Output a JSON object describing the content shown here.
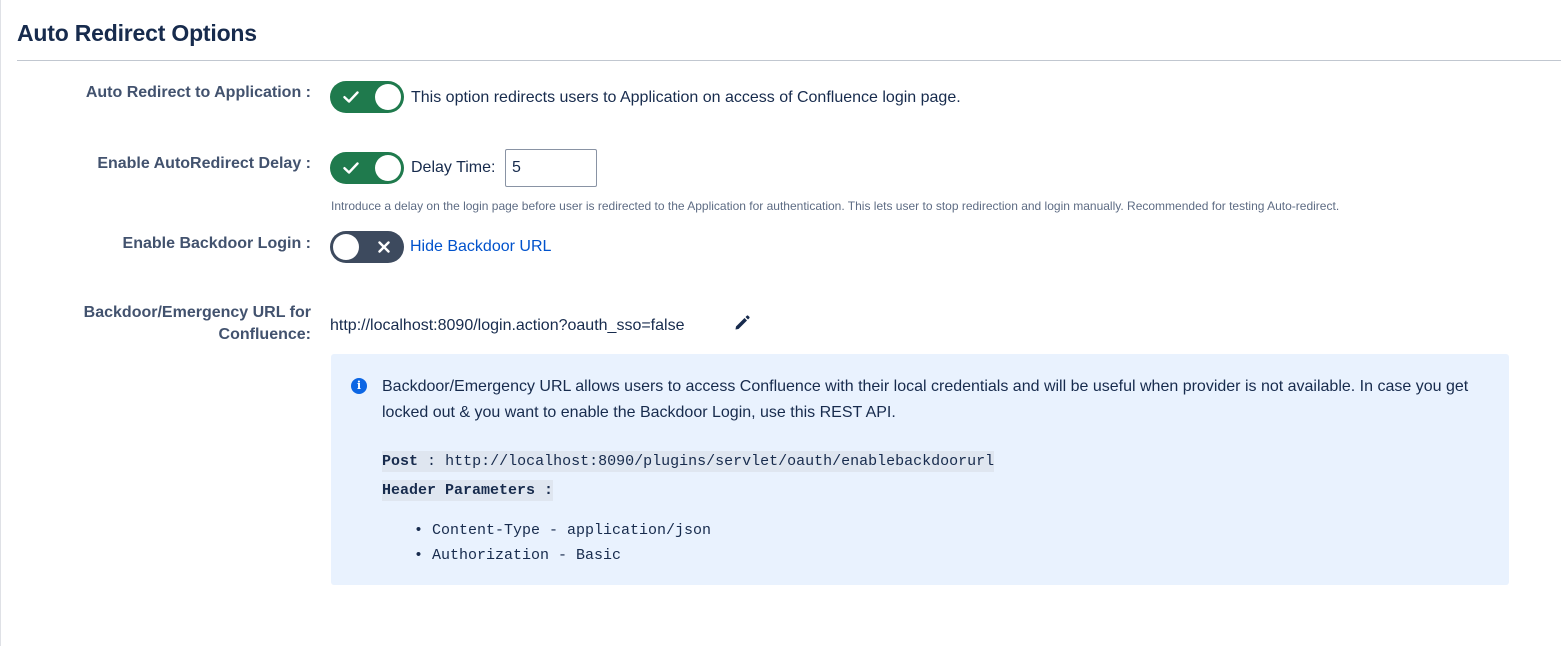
{
  "section": {
    "title": "Auto Redirect Options"
  },
  "auto_redirect": {
    "label": "Auto Redirect to Application :",
    "toggle_state": "on",
    "description": "This option redirects users to Application on access of Confluence login page."
  },
  "autoredirect_delay": {
    "label": "Enable AutoRedirect Delay :",
    "toggle_state": "on",
    "delay_label": "Delay Time:",
    "delay_value": "5",
    "help_text": "Introduce a delay on the login page before user is redirected to the Application for authentication. This lets user to stop redirection and login manually. Recommended for testing Auto-redirect."
  },
  "backdoor_login": {
    "label": "Enable Backdoor Login :",
    "toggle_state": "off",
    "link_label": "Hide Backdoor URL"
  },
  "backdoor_url": {
    "label_line1": "Backdoor/Emergency URL for",
    "label_line2": "Confluence:",
    "url": "http://localhost:8090/login.action?oauth_sso=false",
    "edit_icon": "pencil-icon"
  },
  "info_panel": {
    "icon": "info-icon",
    "message": "Backdoor/Emergency URL allows users to access Confluence with their local credentials and will be useful when provider is not available. In case you get locked out & you want to enable the Backdoor Login, use this REST API.",
    "post_label": "Post",
    "post_separator": ":",
    "post_url": "http://localhost:8090/plugins/servlet/oauth/enablebackdoorurl",
    "header_params_label": "Header Parameters :",
    "headers": [
      "Content-Type - application/json",
      "Authorization - Basic"
    ]
  },
  "colors": {
    "toggle_on": "#1f7a4d",
    "toggle_off": "#3d4a5e",
    "link": "#0052cc",
    "info_bg": "#e9f2fe",
    "info_icon": "#0c66e4"
  }
}
